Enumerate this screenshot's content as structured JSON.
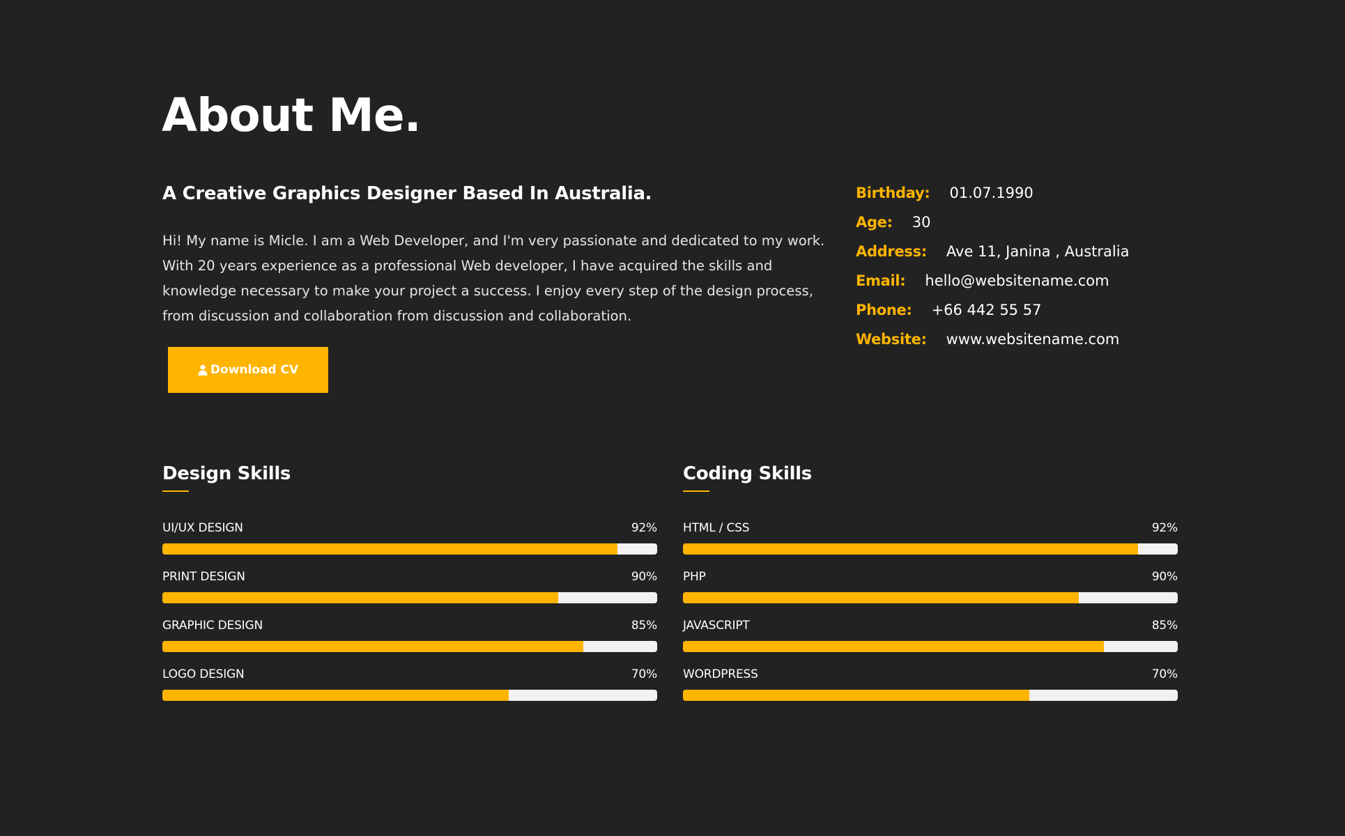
{
  "colors": {
    "background": "#222222",
    "accent": "#ffb400",
    "text": "#ffffff",
    "track": "#f2f2f2"
  },
  "header": {
    "title": "About Me."
  },
  "intro": {
    "heading": "A Creative Graphics Designer Based In Australia.",
    "text": "Hi! My name is Micle. I am a Web Developer, and I'm very passionate and dedicated to my work. With 20 years experience as a professional Web developer, I have acquired the skills and knowledge necessary to make your project a success. I enjoy every step of the design process, from discussion and collaboration from discussion and collaboration.",
    "download_label": "Download CV",
    "download_icon": "user-icon"
  },
  "info": [
    {
      "label": "Birthday:",
      "value": "01.07.1990"
    },
    {
      "label": "Age:",
      "value": "30"
    },
    {
      "label": "Address:",
      "value": "Ave 11, Janina , Australia"
    },
    {
      "label": "Email:",
      "value": "hello@websitename.com"
    },
    {
      "label": "Phone:",
      "value": "+66 442 55 57"
    },
    {
      "label": "Website:",
      "value": "www.websitename.com"
    }
  ],
  "design_skills": {
    "title": "Design Skills",
    "items": [
      {
        "name": "UI/UX DESIGN",
        "percent_label": "92%",
        "fill": 92
      },
      {
        "name": "PRINT DESIGN",
        "percent_label": "90%",
        "fill": 80
      },
      {
        "name": "GRAPHIC DESIGN",
        "percent_label": "85%",
        "fill": 85
      },
      {
        "name": "LOGO DESIGN",
        "percent_label": "70%",
        "fill": 70
      }
    ]
  },
  "coding_skills": {
    "title": "Coding Skills",
    "items": [
      {
        "name": "HTML / CSS",
        "percent_label": "92%",
        "fill": 92
      },
      {
        "name": "PHP",
        "percent_label": "90%",
        "fill": 80
      },
      {
        "name": "JAVASCRIPT",
        "percent_label": "85%",
        "fill": 85
      },
      {
        "name": "WORDPRESS",
        "percent_label": "70%",
        "fill": 70
      }
    ]
  }
}
